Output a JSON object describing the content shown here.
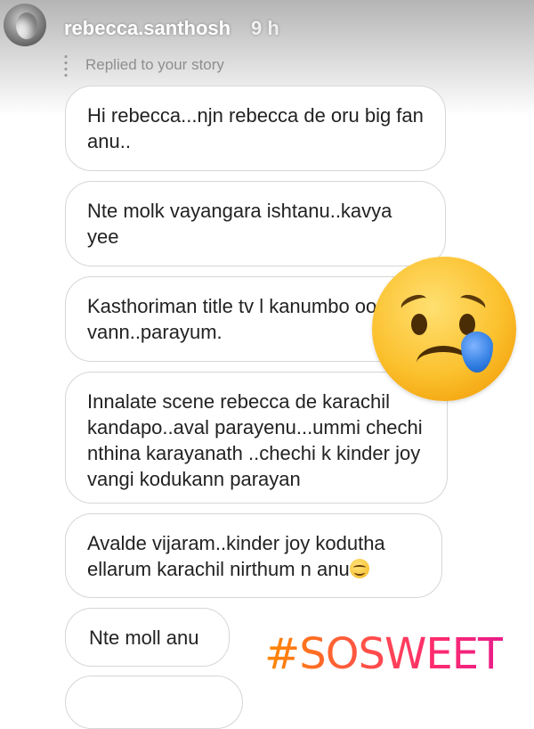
{
  "header": {
    "username": "rebecca.santhosh",
    "time": "9 h",
    "replied_label": "Replied to your story"
  },
  "messages": [
    {
      "text": "Hi rebecca...njn rebecca de oru big fan anu.."
    },
    {
      "text": "Nte molk vayangara ishtanu..kavya yee"
    },
    {
      "text": "Kasthoriman title tv l kanumbo oodi vann..parayum."
    },
    {
      "text": "Innalate scene rebecca de karachil kandapo..aval parayenu...ummi chechi nthina karayanath ..chechi k kinder joy vangi kodukann parayan"
    },
    {
      "text": "Avalde vijaram..kinder joy kodutha ellarum karachil nirthum n anu"
    },
    {
      "text": "Nte moll anu"
    }
  ],
  "stickers": {
    "hashtag": "#SOSWEET",
    "emoji_large": "crying-face-icon",
    "emoji_inline": "smiling-face-icon"
  },
  "colors": {
    "hashtag_gradient": [
      "#ff8a00",
      "#ff2d6e"
    ],
    "bubble_border": "#d6d6d6",
    "text": "#222222",
    "meta_text": "#8e8e8e"
  }
}
